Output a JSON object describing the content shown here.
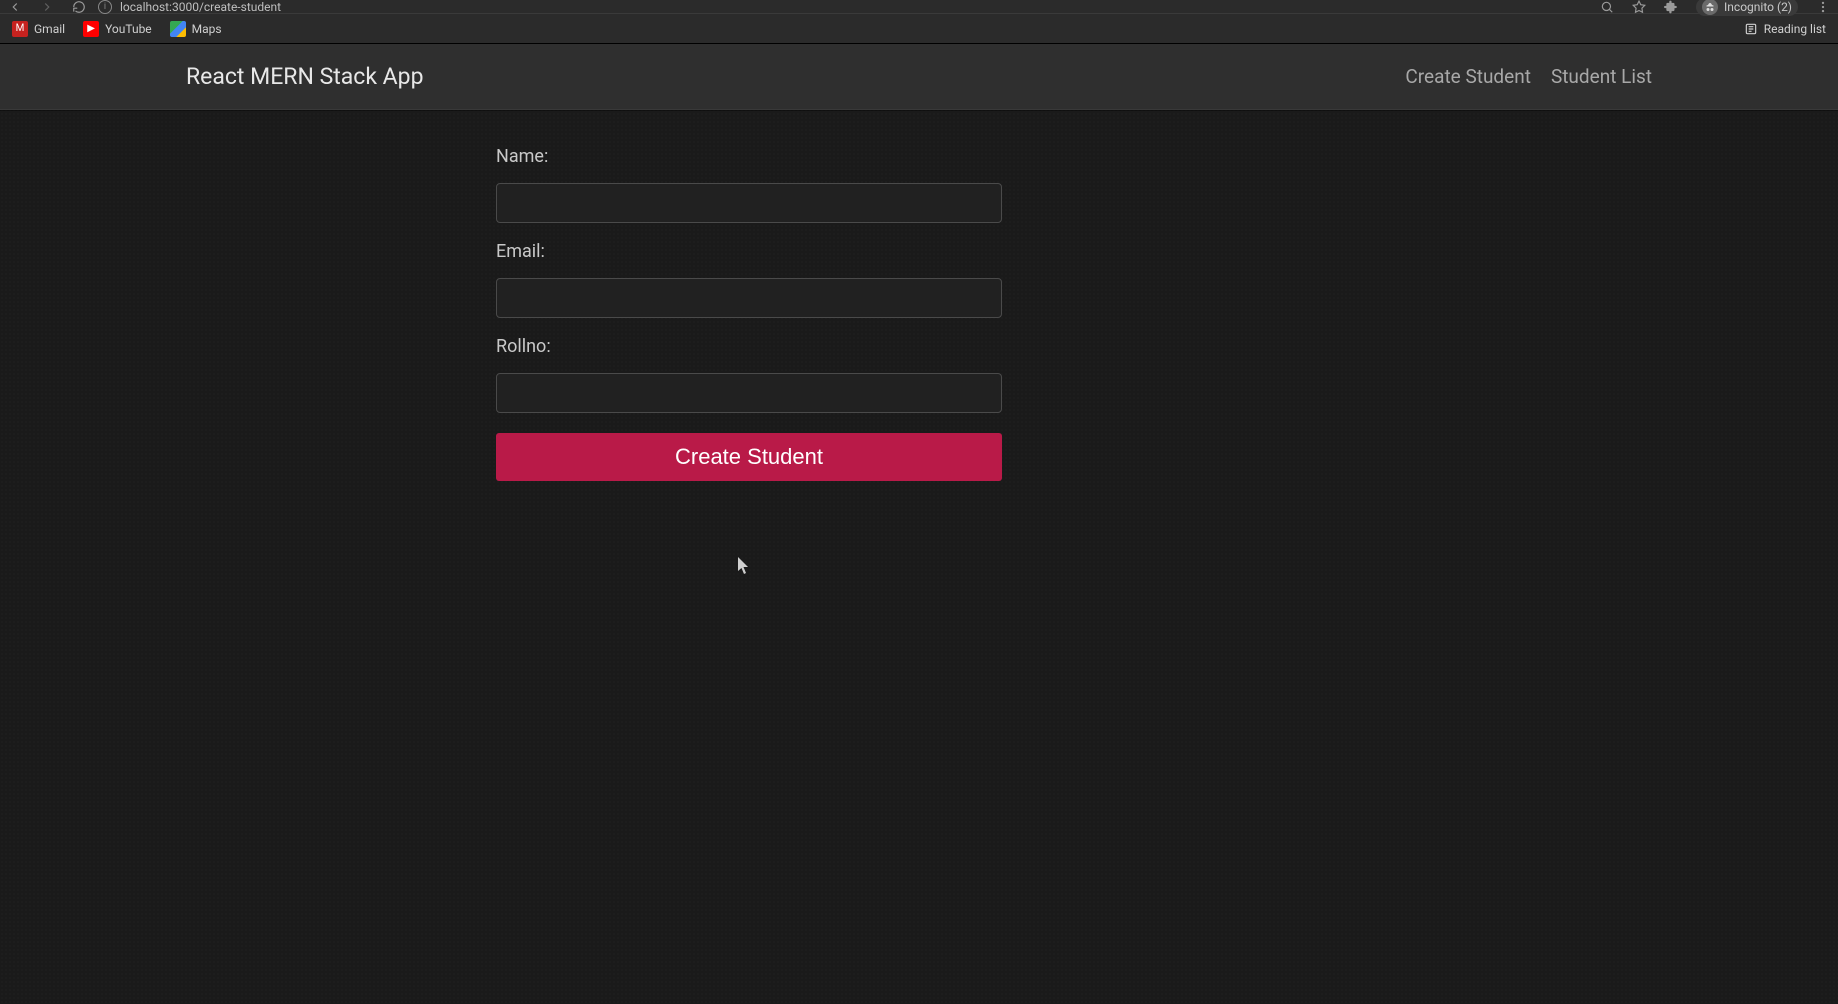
{
  "browser": {
    "url": "localhost:3000/create-student",
    "incognito_label": "Incognito (2)",
    "bookmarks": {
      "gmail": "Gmail",
      "youtube": "YouTube",
      "maps": "Maps"
    },
    "reading_list": "Reading list"
  },
  "navbar": {
    "title": "React MERN Stack App",
    "links": {
      "create": "Create Student",
      "list": "Student List"
    }
  },
  "form": {
    "name": {
      "label": "Name:",
      "value": ""
    },
    "email": {
      "label": "Email:",
      "value": ""
    },
    "rollno": {
      "label": "Rollno:",
      "value": ""
    },
    "submit_label": "Create Student"
  }
}
